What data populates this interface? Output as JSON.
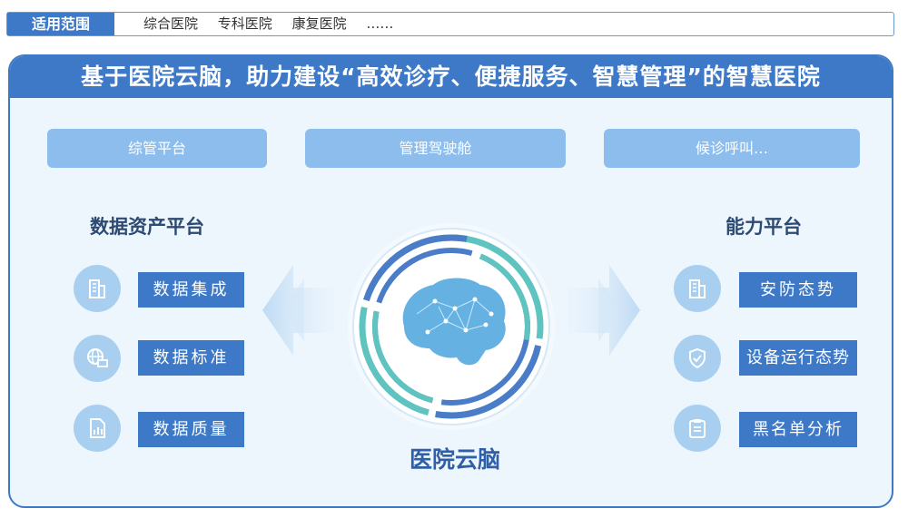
{
  "scope": {
    "tag": "适用范围",
    "items": [
      "综合医院",
      "专科医院",
      "康复医院",
      "……"
    ]
  },
  "main": {
    "title": "基于医院云脑，助力建设“高效诊疗、便捷服务、智慧管理”的智慧医院",
    "top_pills": [
      "综管平台",
      "管理驾驶舱",
      "候诊呼叫…"
    ],
    "left": {
      "title": "数据资产平台",
      "items": [
        {
          "label": "数据集成",
          "icon": "building-icon"
        },
        {
          "label": "数据标准",
          "icon": "globe-monitor-icon"
        },
        {
          "label": "数据质量",
          "icon": "report-chart-icon"
        }
      ]
    },
    "right": {
      "title": "能力平台",
      "items": [
        {
          "label": "安防态势",
          "icon": "building-icon"
        },
        {
          "label": "设备运行态势",
          "icon": "shield-check-icon"
        },
        {
          "label": "黑名单分析",
          "icon": "clipboard-list-icon"
        }
      ]
    },
    "center": {
      "label": "医院云脑",
      "icon": "brain-icon"
    }
  },
  "colors": {
    "primary": "#3e79c8",
    "pill": "#8dbdec",
    "card_bg": "#eef6fd",
    "ring_teal": "#5fc3c0",
    "ring_blue": "#4a7cc8"
  }
}
